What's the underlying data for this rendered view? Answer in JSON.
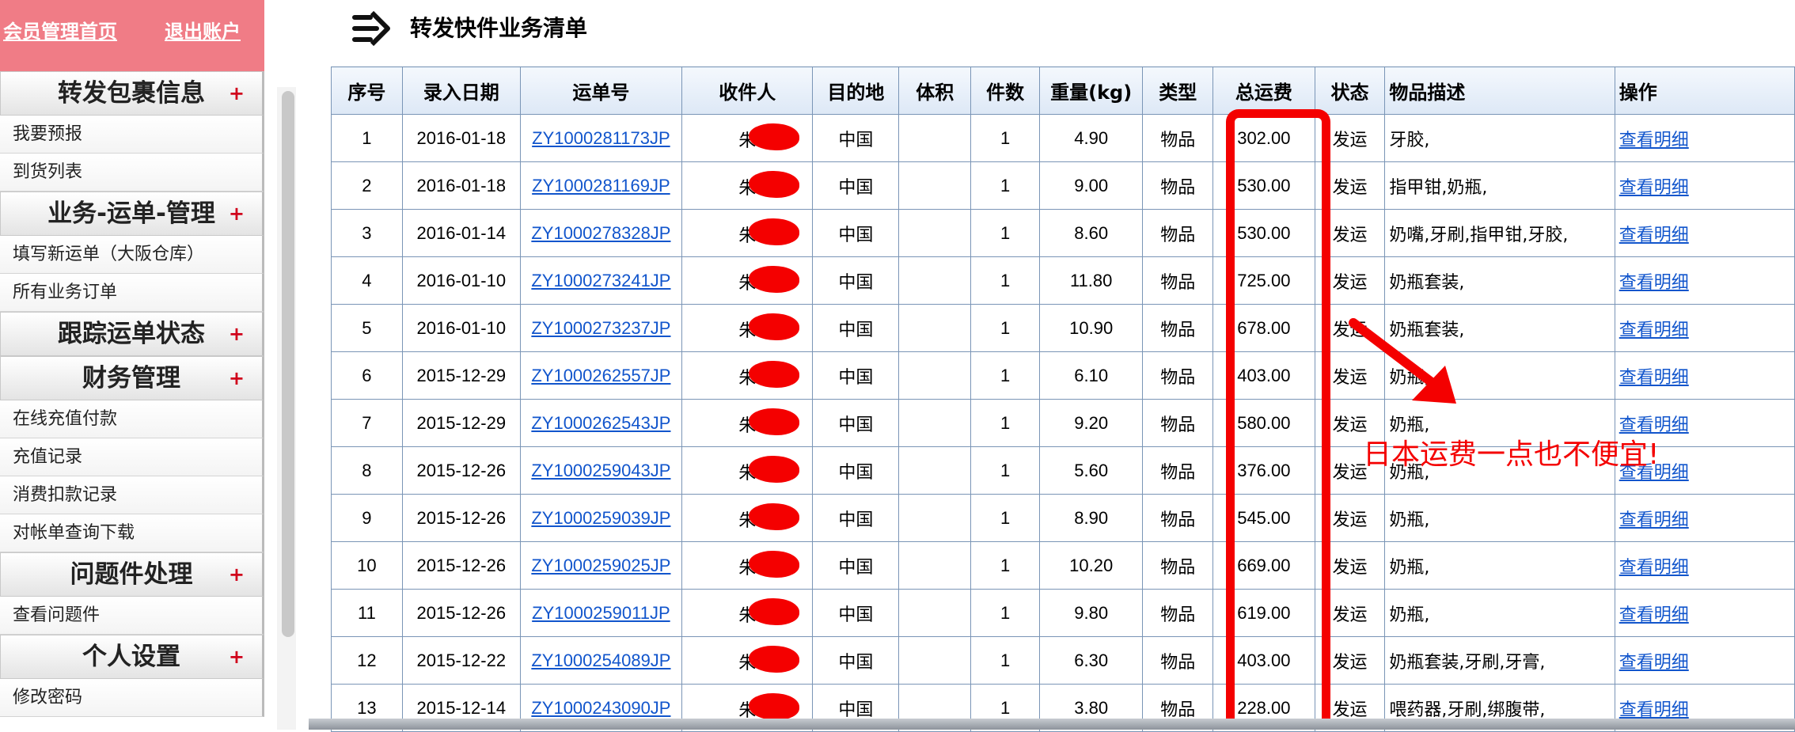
{
  "top_links": {
    "home": "会员管理首页",
    "logout": "退出账户"
  },
  "sidebar": {
    "sections": [
      {
        "title": "转发包裹信息",
        "items": [
          "我要预报",
          "到货列表"
        ]
      },
      {
        "title": "业务-运单-管理",
        "items": [
          "填写新运单（大阪仓库）",
          "所有业务订单"
        ]
      },
      {
        "title": "跟踪运单状态",
        "items": []
      },
      {
        "title": "财务管理",
        "items": [
          "在线充值付款",
          "充值记录",
          "消费扣款记录",
          "对帐单查询下载"
        ]
      },
      {
        "title": "问题件处理",
        "items": [
          "查看问题件"
        ]
      },
      {
        "title": "个人设置",
        "items": [
          "修改密码"
        ]
      }
    ],
    "plus": "+"
  },
  "header": {
    "title": "转发快件业务清单",
    "icon": "double-arrow-right-icon"
  },
  "table": {
    "columns": [
      "序号",
      "录入日期",
      "运单号",
      "收件人",
      "目的地",
      "体积",
      "件数",
      "重量(kg)",
      "类型",
      "总运费",
      "状态",
      "物品描述",
      "操作"
    ],
    "rows": [
      {
        "no": "1",
        "date": "2016-01-18",
        "waybill": "ZY1000281173JP",
        "recipient": "朱",
        "dest": "中国",
        "volume": "",
        "pieces": "1",
        "weight": "4.90",
        "type": "物品",
        "fee": "302.00",
        "status": "发运",
        "desc": "牙胶,",
        "action": "查看明细"
      },
      {
        "no": "2",
        "date": "2016-01-18",
        "waybill": "ZY1000281169JP",
        "recipient": "朱",
        "dest": "中国",
        "volume": "",
        "pieces": "1",
        "weight": "9.00",
        "type": "物品",
        "fee": "530.00",
        "status": "发运",
        "desc": "指甲钳,奶瓶,",
        "action": "查看明细"
      },
      {
        "no": "3",
        "date": "2016-01-14",
        "waybill": "ZY1000278328JP",
        "recipient": "朱",
        "dest": "中国",
        "volume": "",
        "pieces": "1",
        "weight": "8.60",
        "type": "物品",
        "fee": "530.00",
        "status": "发运",
        "desc": "奶嘴,牙刷,指甲钳,牙胶,",
        "action": "查看明细"
      },
      {
        "no": "4",
        "date": "2016-01-10",
        "waybill": "ZY1000273241JP",
        "recipient": "朱",
        "dest": "中国",
        "volume": "",
        "pieces": "1",
        "weight": "11.80",
        "type": "物品",
        "fee": "725.00",
        "status": "发运",
        "desc": "奶瓶套装,",
        "action": "查看明细"
      },
      {
        "no": "5",
        "date": "2016-01-10",
        "waybill": "ZY1000273237JP",
        "recipient": "朱",
        "dest": "中国",
        "volume": "",
        "pieces": "1",
        "weight": "10.90",
        "type": "物品",
        "fee": "678.00",
        "status": "发运",
        "desc": "奶瓶套装,",
        "action": "查看明细"
      },
      {
        "no": "6",
        "date": "2015-12-29",
        "waybill": "ZY1000262557JP",
        "recipient": "朱",
        "dest": "中国",
        "volume": "",
        "pieces": "1",
        "weight": "6.10",
        "type": "物品",
        "fee": "403.00",
        "status": "发运",
        "desc": "奶瓶,",
        "action": "查看明细"
      },
      {
        "no": "7",
        "date": "2015-12-29",
        "waybill": "ZY1000262543JP",
        "recipient": "朱",
        "dest": "中国",
        "volume": "",
        "pieces": "1",
        "weight": "9.20",
        "type": "物品",
        "fee": "580.00",
        "status": "发运",
        "desc": "奶瓶,",
        "action": "查看明细"
      },
      {
        "no": "8",
        "date": "2015-12-26",
        "waybill": "ZY1000259043JP",
        "recipient": "朱",
        "dest": "中国",
        "volume": "",
        "pieces": "1",
        "weight": "5.60",
        "type": "物品",
        "fee": "376.00",
        "status": "发运",
        "desc": "奶瓶,",
        "action": "查看明细"
      },
      {
        "no": "9",
        "date": "2015-12-26",
        "waybill": "ZY1000259039JP",
        "recipient": "朱",
        "dest": "中国",
        "volume": "",
        "pieces": "1",
        "weight": "8.90",
        "type": "物品",
        "fee": "545.00",
        "status": "发运",
        "desc": "奶瓶,",
        "action": "查看明细"
      },
      {
        "no": "10",
        "date": "2015-12-26",
        "waybill": "ZY1000259025JP",
        "recipient": "朱",
        "dest": "中国",
        "volume": "",
        "pieces": "1",
        "weight": "10.20",
        "type": "物品",
        "fee": "669.00",
        "status": "发运",
        "desc": "奶瓶,",
        "action": "查看明细"
      },
      {
        "no": "11",
        "date": "2015-12-26",
        "waybill": "ZY1000259011JP",
        "recipient": "朱",
        "dest": "中国",
        "volume": "",
        "pieces": "1",
        "weight": "9.80",
        "type": "物品",
        "fee": "619.00",
        "status": "发运",
        "desc": "奶瓶,",
        "action": "查看明细"
      },
      {
        "no": "12",
        "date": "2015-12-22",
        "waybill": "ZY1000254089JP",
        "recipient": "朱",
        "dest": "中国",
        "volume": "",
        "pieces": "1",
        "weight": "6.30",
        "type": "物品",
        "fee": "403.00",
        "status": "发运",
        "desc": "奶瓶套装,牙刷,牙膏,",
        "action": "查看明细"
      },
      {
        "no": "13",
        "date": "2015-12-14",
        "waybill": "ZY1000243090JP",
        "recipient": "朱",
        "dest": "中国",
        "volume": "",
        "pieces": "1",
        "weight": "3.80",
        "type": "物品",
        "fee": "228.00",
        "status": "发运",
        "desc": "喂药器,牙刷,绑腹带,",
        "action": "查看明细"
      }
    ]
  },
  "annotation": {
    "text": "日本运费一点也不便宜!",
    "color": "#f40000"
  },
  "colors": {
    "accent_pink": "#f07c86",
    "link_blue": "#1155cc",
    "table_border": "#7a95b6",
    "annotation_red": "#f40000"
  }
}
